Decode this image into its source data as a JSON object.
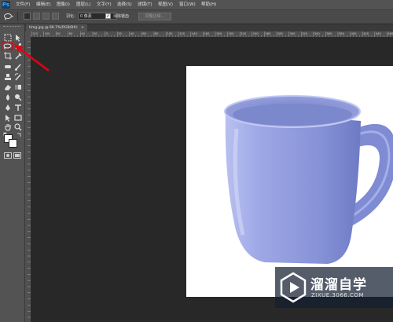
{
  "app": {
    "logo_text": "Ps"
  },
  "menu": {
    "items": [
      "文件(F)",
      "编辑(E)",
      "图像(I)",
      "图层(L)",
      "文字(Y)",
      "选择(S)",
      "滤镜(T)",
      "视图(V)",
      "窗口(W)",
      "帮助(H)"
    ]
  },
  "options": {
    "feather_label": "羽化:",
    "feather_value": "0 像素",
    "antialias_label": "消除锯齿",
    "antialias_checked": "✓",
    "refine_edge": "调整边缘..."
  },
  "document": {
    "tab_title": "timg.jpg @ 66.7%(RGB/8#)",
    "close_glyph": "×"
  },
  "ruler": {
    "h_labels": [
      "120",
      "100",
      "80",
      "60",
      "40",
      "20",
      "0",
      "20",
      "40",
      "60",
      "80",
      "100",
      "120",
      "140",
      "160",
      "180",
      "200",
      "220",
      "240",
      "260",
      "280",
      "300",
      "320",
      "340",
      "360",
      "380",
      "400",
      "420",
      "440",
      "460"
    ]
  },
  "watermark": {
    "title": "溜溜自学",
    "url": "ZIXUE.3066.COM"
  },
  "colors": {
    "highlight": "#e60012",
    "mug": "#8e9ad6",
    "background": "#282828"
  }
}
